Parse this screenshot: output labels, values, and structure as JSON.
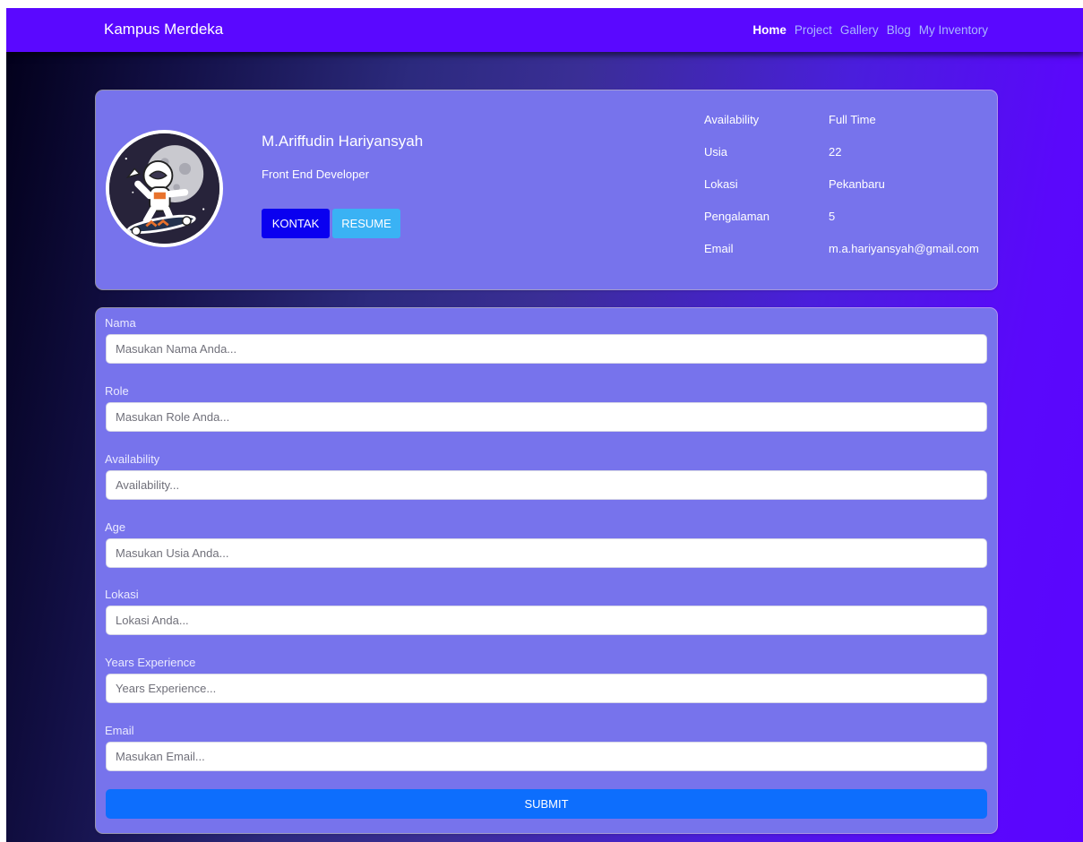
{
  "navbar": {
    "brand": "Kampus Merdeka",
    "links": [
      {
        "label": "Home",
        "active": true
      },
      {
        "label": "Project",
        "active": false
      },
      {
        "label": "Gallery",
        "active": false
      },
      {
        "label": "Blog",
        "active": false
      },
      {
        "label": "My Inventory",
        "active": false
      }
    ]
  },
  "profile": {
    "name": "M.Ariffudin Hariyansyah",
    "role": "Front End Developer",
    "buttons": {
      "kontak": "KONTAK",
      "resume": "RESUME"
    },
    "info": [
      {
        "label": "Availability",
        "value": "Full Time"
      },
      {
        "label": "Usia",
        "value": "22"
      },
      {
        "label": "Lokasi",
        "value": "Pekanbaru"
      },
      {
        "label": "Pengalaman",
        "value": "5"
      },
      {
        "label": "Email",
        "value": "m.a.hariyansyah@gmail.com"
      }
    ]
  },
  "form": {
    "fields": [
      {
        "label": "Nama",
        "placeholder": "Masukan Nama Anda...",
        "value": ""
      },
      {
        "label": "Role",
        "placeholder": "Masukan Role Anda...",
        "value": ""
      },
      {
        "label": "Availability",
        "placeholder": "Availability...",
        "value": ""
      },
      {
        "label": "Age",
        "placeholder": "Masukan Usia Anda...",
        "value": ""
      },
      {
        "label": "Lokasi",
        "placeholder": "Lokasi Anda...",
        "value": ""
      },
      {
        "label": "Years Experience",
        "placeholder": "Years Experience...",
        "value": ""
      },
      {
        "label": "Email",
        "placeholder": "Masukan Email...",
        "value": ""
      }
    ],
    "submit_label": "SUBMIT"
  },
  "icons": {
    "avatar": "astronaut-skateboard-avatar"
  },
  "colors": {
    "navbar": "#5a08ff",
    "card": "#7773ec",
    "kontak_button": "#0a00f0",
    "resume_button": "#3ab2f4",
    "submit_button": "#0d6efd"
  }
}
